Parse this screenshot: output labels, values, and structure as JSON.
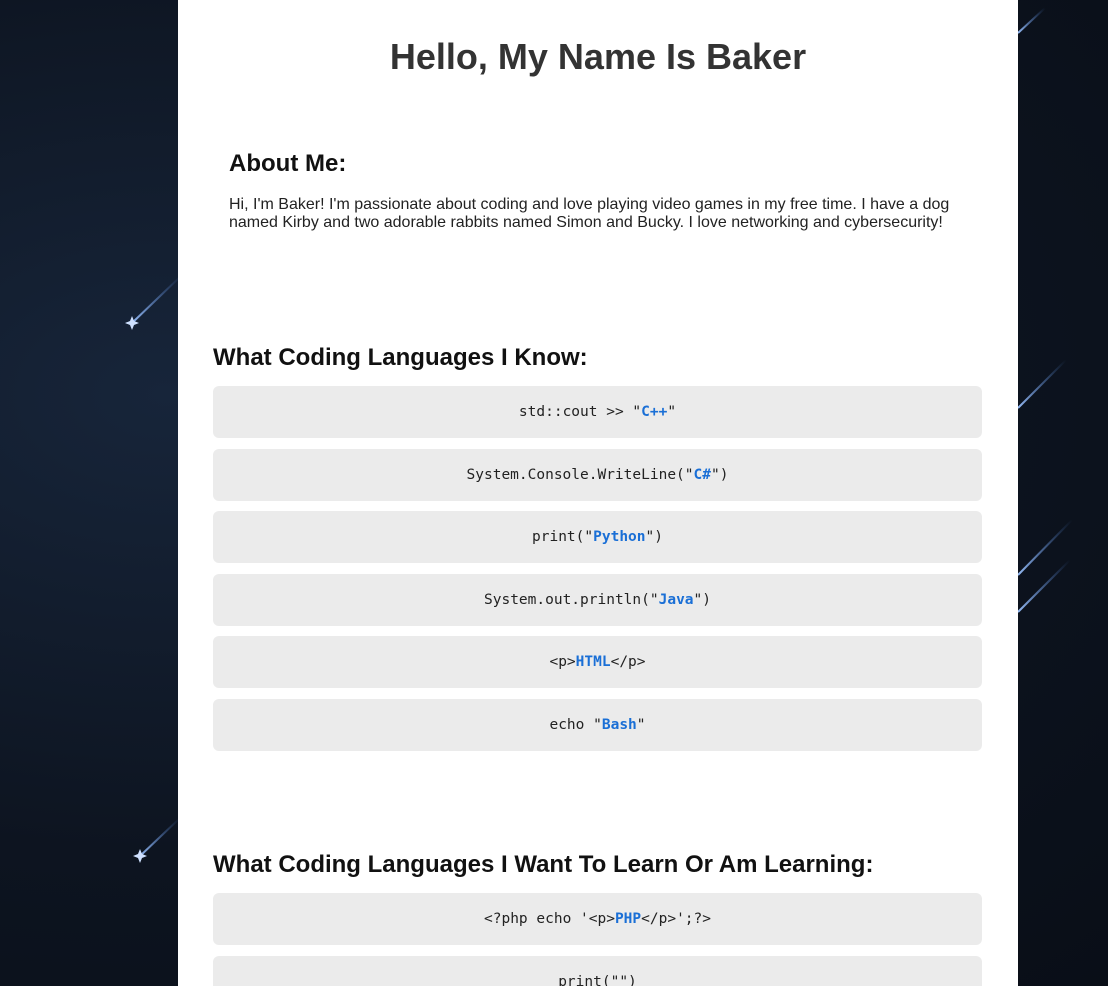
{
  "page_title": "Hello, My Name Is Baker",
  "about": {
    "heading": "About Me:",
    "text": "Hi, I'm Baker! I'm passionate about coding and love playing video games in my free time. I have a dog named Kirby and two adorable rabbits named Simon and Bucky. I love networking and cybersecurity!"
  },
  "known": {
    "heading": "What Coding Languages I Know:",
    "items": [
      {
        "prefix": "std::cout >> \"",
        "name": "C++",
        "suffix": "\""
      },
      {
        "prefix": "System.Console.WriteLine(\"",
        "name": "C#",
        "suffix": "\")"
      },
      {
        "prefix": "print(\"",
        "name": "Python",
        "suffix": "\")"
      },
      {
        "prefix": "System.out.println(\"",
        "name": "Java",
        "suffix": "\")"
      },
      {
        "prefix": "<p>",
        "name": "HTML",
        "suffix": "</p>"
      },
      {
        "prefix": "echo \"",
        "name": "Bash",
        "suffix": "\""
      }
    ]
  },
  "learning": {
    "heading": "What Coding Languages I Want To Learn Or Am Learning:",
    "items": [
      {
        "prefix": "<?php echo '<p>",
        "name": "PHP",
        "suffix": "</p>';?>"
      },
      {
        "prefix": "print(\"",
        "name": "",
        "suffix": "\")"
      }
    ]
  },
  "colors": {
    "background": "#0d1420",
    "code_block": "#ebebeb",
    "keyword": "#1a6fd6"
  }
}
